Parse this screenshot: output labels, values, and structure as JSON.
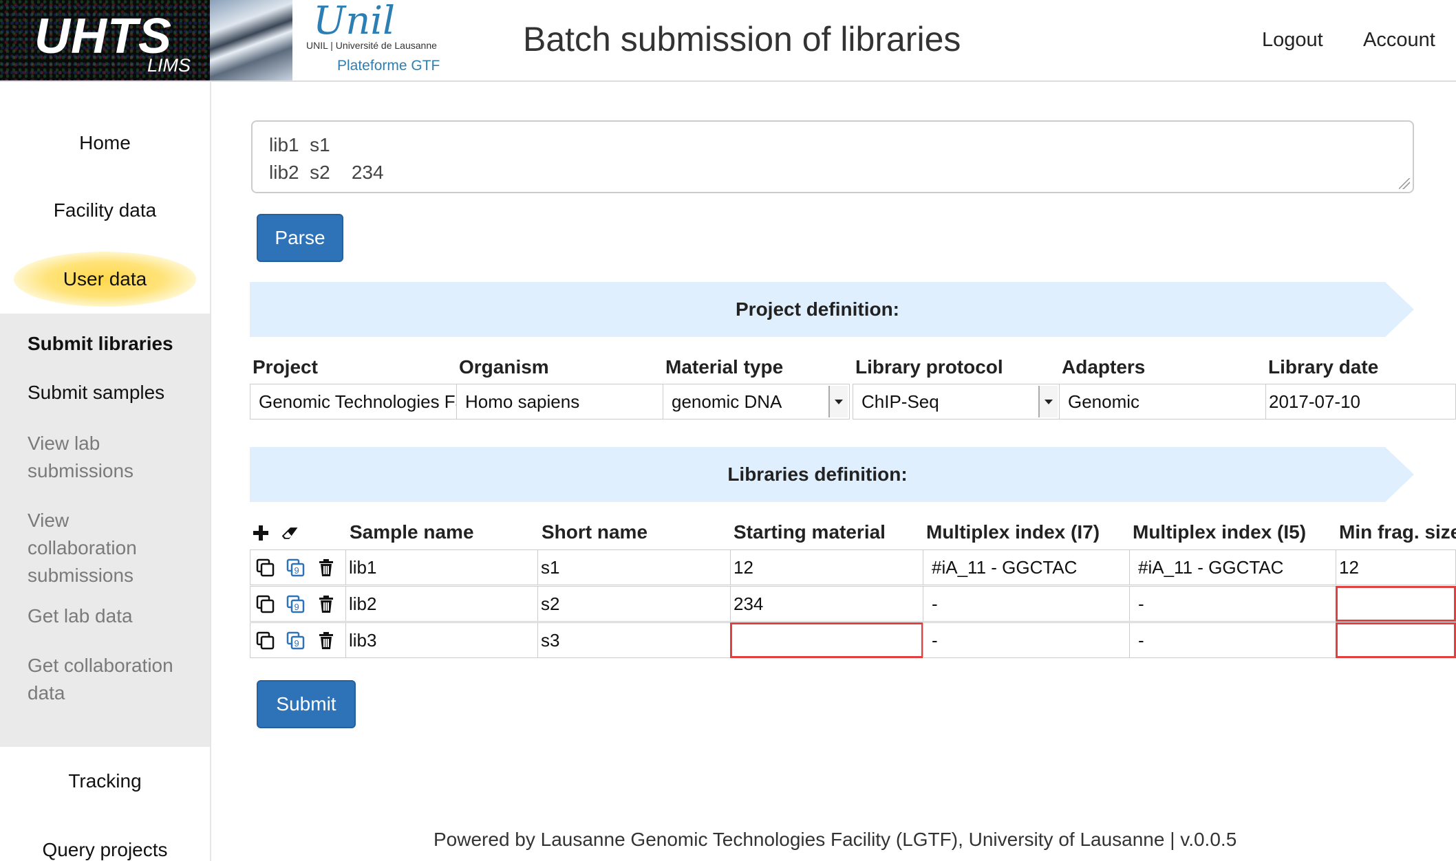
{
  "header": {
    "logo_main": "UHTS",
    "logo_sub": "LIMS",
    "unil_script": "Unil",
    "unil_line": "UNIL | Université de Lausanne",
    "unil_platform": "Plateforme GTF",
    "title": "Batch submission of libraries",
    "logout": "Logout",
    "account": "Account"
  },
  "sidebar": {
    "home": "Home",
    "facility_data": "Facility data",
    "user_data": "User data",
    "sub_items": [
      {
        "label": "Submit libraries"
      },
      {
        "label": "Submit samples"
      },
      {
        "label": "View lab submissions"
      },
      {
        "label": "View collaboration submissions"
      },
      {
        "label": "Get lab data"
      },
      {
        "label": "Get collaboration data"
      }
    ],
    "tracking": "Tracking",
    "query_projects": "Query projects"
  },
  "input": {
    "lines": [
      "lib1  s1",
      "lib2  s2    234"
    ],
    "parse_label": "Parse"
  },
  "project": {
    "banner": "Project definition:",
    "headers": [
      "Project",
      "Organism",
      "Material type",
      "Library protocol",
      "Adapters",
      "Library date"
    ],
    "values": [
      "Genomic Technologies Facility",
      "Homo sapiens",
      "genomic DNA",
      "ChIP-Seq",
      "Genomic",
      "2017-07-10"
    ]
  },
  "libraries": {
    "banner": "Libraries definition:",
    "headers": [
      "Sample name",
      "Short name",
      "Starting material",
      "Multiplex index (I7)",
      "Multiplex index (I5)",
      "Min frag. size"
    ],
    "rows": [
      {
        "sample": "lib1",
        "short": "s1",
        "starting": "12",
        "i7": "#iA_11 - GGCTAC",
        "i5": "#iA_11 - GGCTAC",
        "minfrag": "12"
      },
      {
        "sample": "lib2",
        "short": "s2",
        "starting": "234",
        "i7": "-",
        "i5": "-",
        "minfrag": ""
      },
      {
        "sample": "lib3",
        "short": "s3",
        "starting": "",
        "i7": "-",
        "i5": "-",
        "minfrag": ""
      }
    ],
    "submit_label": "Submit"
  },
  "footer": "Powered by Lausanne Genomic Technologies Facility (LGTF), University of Lausanne | v.0.0.5",
  "colors": {
    "primary_button": "#2e72b8",
    "banner": "#e0effd",
    "active_glow": "#ffd84a",
    "invalid_border": "#e04040"
  },
  "icons": [
    "plus-icon",
    "eraser-icon",
    "copy-icon",
    "paste-icon",
    "trash-icon",
    "dropdown-arrow-icon"
  ]
}
